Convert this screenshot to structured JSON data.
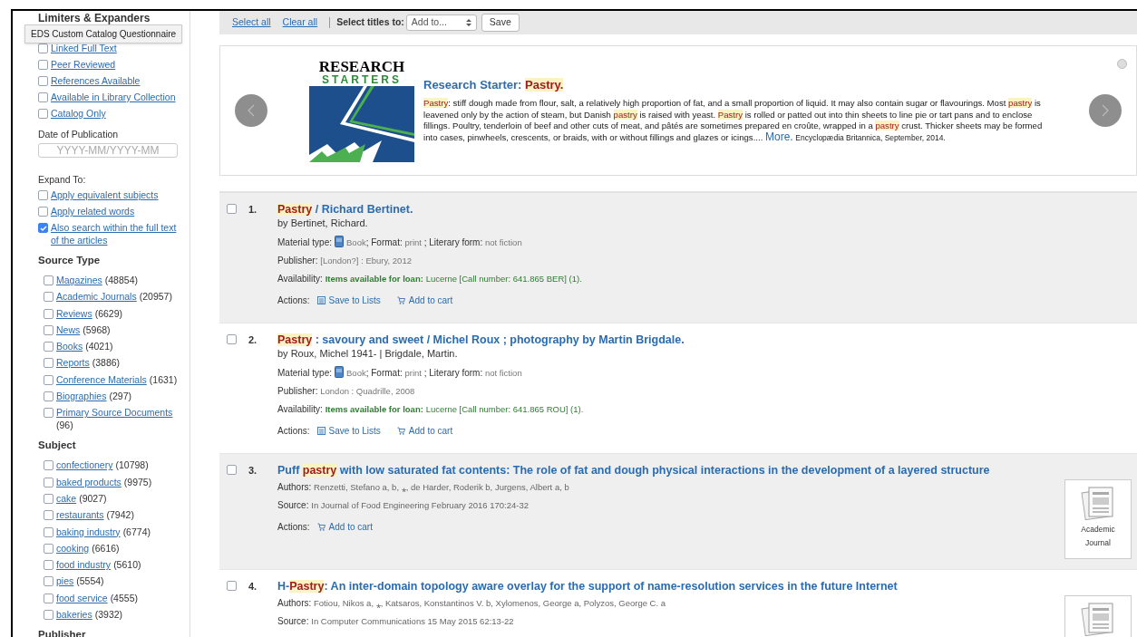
{
  "tooltip": "EDS Custom Catalog Questionnaire",
  "sidebar": {
    "heading": "Limiters & Expanders",
    "limiters": [
      {
        "label": "Linked Full Text",
        "checked": false
      },
      {
        "label": "Peer Reviewed",
        "checked": false
      },
      {
        "label": "References Available",
        "checked": false
      },
      {
        "label": "Available in Library Collection",
        "checked": false
      },
      {
        "label": "Catalog Only",
        "checked": false
      }
    ],
    "date": {
      "label": "Date of Publication",
      "placeholder": "YYYY-MM/YYYY-MM"
    },
    "expand": {
      "label": "Expand To:",
      "items": [
        {
          "label": "Apply equivalent subjects",
          "checked": false
        },
        {
          "label": "Apply related words",
          "checked": false
        },
        {
          "label": "Also search within the full text of the articles",
          "checked": true
        }
      ]
    },
    "facets": [
      {
        "heading": "Source Type",
        "items": [
          {
            "label": "Magazines",
            "count": "(48854)",
            "checked": false
          },
          {
            "label": "Academic Journals",
            "count": "(20957)",
            "checked": false
          },
          {
            "label": "Reviews",
            "count": "(6629)",
            "checked": false
          },
          {
            "label": "News",
            "count": "(5968)",
            "checked": false
          },
          {
            "label": "Books",
            "count": "(4021)",
            "checked": false
          },
          {
            "label": "Reports",
            "count": "(3886)",
            "checked": false
          },
          {
            "label": "Conference Materials",
            "count": "(1631)",
            "checked": false
          },
          {
            "label": "Biographies",
            "count": "(297)",
            "checked": false
          },
          {
            "label": "Primary Source Documents",
            "count": "(96)",
            "checked": false
          }
        ]
      },
      {
        "heading": "Subject",
        "items": [
          {
            "label": "confectionery",
            "count": "(10798)",
            "checked": false
          },
          {
            "label": "baked products",
            "count": "(9975)",
            "checked": false
          },
          {
            "label": "cake",
            "count": "(9027)",
            "checked": false
          },
          {
            "label": "restaurants",
            "count": "(7942)",
            "checked": false
          },
          {
            "label": "baking industry",
            "count": "(6774)",
            "checked": false
          },
          {
            "label": "cooking",
            "count": "(6616)",
            "checked": false
          },
          {
            "label": "food industry",
            "count": "(5610)",
            "checked": false
          },
          {
            "label": "pies",
            "count": "(5554)",
            "checked": false
          },
          {
            "label": "food service",
            "count": "(4555)",
            "checked": false
          },
          {
            "label": "bakeries",
            "count": "(3932)",
            "checked": false
          }
        ]
      },
      {
        "heading": "Publisher"
      }
    ]
  },
  "toolbar": {
    "select_all": "Select all",
    "clear_all": "Clear all",
    "select_label": "Select titles to:",
    "select_value": "Add to...",
    "save": "Save"
  },
  "research_starter": {
    "logo_top": "RESEARCH",
    "logo_bottom": "STARTERS",
    "title_prefix": "Research Starter:",
    "title_term": "Pastry.",
    "summary": [
      {
        "text": "Pastry",
        "highlight": true
      },
      {
        "text": ": stiff dough made from flour, salt, a relatively high proportion of fat, and a small proportion of liquid. It may also contain sugar or flavourings. Most ",
        "highlight": false
      },
      {
        "text": "pastry",
        "highlight": true
      },
      {
        "text": " is leavened only by the action of steam, but Danish ",
        "highlight": false
      },
      {
        "text": "pastry",
        "highlight": true
      },
      {
        "text": " is raised with yeast. ",
        "highlight": false
      },
      {
        "text": "Pastry",
        "highlight": true
      },
      {
        "text": " is rolled or patted out into thin sheets to line pie or tart pans and to enclose fillings. Poultry, tenderloin of beef and other cuts of meat, and pâtés are sometimes prepared en croûte, wrapped in a ",
        "highlight": false
      },
      {
        "text": "pastry",
        "highlight": true
      },
      {
        "text": " crust. Thicker sheets may be formed into cases, pinwheels, crescents, or braids, with or without fillings and glazes or icings.... ",
        "highlight": false
      }
    ],
    "more": "More.",
    "source": "Encyclopædia Britannica, September, 2014.",
    "indicators": [
      {
        "selected": false
      }
    ]
  },
  "results": [
    {
      "kind": "catalog",
      "number": "1.",
      "checked": false,
      "shaded": true,
      "title": [
        {
          "text": "Pastry",
          "highlight": true
        },
        {
          "text": " / Richard Bertinet.",
          "highlight": false
        }
      ],
      "byline": "by Bertinet, Richard.",
      "material": {
        "label": "Material type:",
        "type": "Book",
        "format_label": "; Format:",
        "format": "print",
        "form_label": " ; Literary form:",
        "form": "not fiction"
      },
      "publisher": {
        "label": "Publisher:",
        "value": "[London?] : Ebury, 2012"
      },
      "availability": {
        "label": "Availability:",
        "status": "Items available for loan:",
        "detail": "Lucerne [Call number: 641.865 BER] (1)."
      },
      "actions_label": "Actions:",
      "actions": [
        {
          "kind": "lists",
          "label": "Save to Lists"
        },
        {
          "kind": "cart",
          "label": "Add to cart"
        }
      ]
    },
    {
      "kind": "catalog",
      "number": "2.",
      "checked": false,
      "shaded": false,
      "title": [
        {
          "text": "Pastry",
          "highlight": true
        },
        {
          "text": " : savoury and sweet / Michel Roux ; photography by Martin Brigdale.",
          "highlight": false
        }
      ],
      "byline": "by Roux, Michel 1941- | Brigdale, Martin.",
      "material": {
        "label": "Material type:",
        "type": "Book",
        "format_label": "; Format:",
        "format": "print",
        "form_label": " ; Literary form:",
        "form": "not fiction"
      },
      "publisher": {
        "label": "Publisher:",
        "value": "London : Quadrille, 2008"
      },
      "availability": {
        "label": "Availability:",
        "status": "Items available for loan:",
        "detail": "Lucerne [Call number: 641.865 ROU] (1)."
      },
      "actions_label": "Actions:",
      "actions": [
        {
          "kind": "lists",
          "label": "Save to Lists"
        },
        {
          "kind": "cart",
          "label": "Add to cart"
        }
      ]
    },
    {
      "kind": "article",
      "number": "3.",
      "checked": false,
      "shaded": true,
      "title": [
        {
          "text": "Puff ",
          "highlight": false
        },
        {
          "text": "pastry",
          "highlight": true
        },
        {
          "text": " with low saturated fat contents: The role of fat and dough physical interactions in the development of a layered structure",
          "highlight": false
        }
      ],
      "authors": {
        "label": "Authors:",
        "value": "Renzetti, Stefano a, b, ⁎, de Harder, Roderik b, Jurgens, Albert a, b"
      },
      "source": {
        "label": "Source:",
        "value": "In Journal of Food Engineering February 2016 170:24-32"
      },
      "actions_label": "Actions:",
      "actions": [
        {
          "kind": "cart",
          "label": "Add to cart"
        }
      ],
      "thumbnail_label": "Academic Journal"
    },
    {
      "kind": "article",
      "number": "4.",
      "checked": false,
      "shaded": false,
      "title": [
        {
          "text": "H-",
          "highlight": false
        },
        {
          "text": "Pastry",
          "highlight": true
        },
        {
          "text": ": An inter-domain topology aware overlay for the support of name-resolution services in the future Internet",
          "highlight": false
        }
      ],
      "authors": {
        "label": "Authors:",
        "value": "Fotiou, Nikos a, ⁎, Katsaros, Konstantinos V. b, Xylomenos, George a, Polyzos, George C. a"
      },
      "source": {
        "label": "Source:",
        "value": "In Computer Communications 15 May 2015 62:13-22"
      }
    }
  ]
}
